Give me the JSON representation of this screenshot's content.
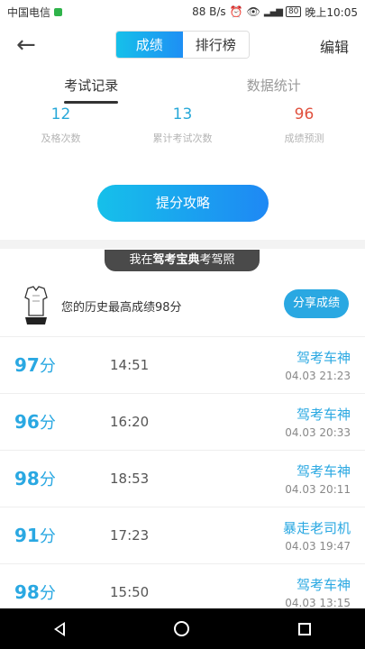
{
  "status": {
    "carrier": "中国电信",
    "speed": "88 B/s",
    "battery": "80",
    "time": "晚上10:05"
  },
  "nav": {
    "back_icon": "arrow-left-icon",
    "seg_active": "成绩",
    "seg_inactive": "排行榜",
    "edit": "编辑"
  },
  "subtabs": [
    "考试记录",
    "数据统计"
  ],
  "stats": [
    {
      "value": "12",
      "label": "及格次数"
    },
    {
      "value": "13",
      "label": "累计考试次数"
    },
    {
      "value": "96",
      "label": "成绩预测"
    }
  ],
  "cta": "提分攻略",
  "banner": {
    "pre": "我在",
    "brand": "驾考宝典",
    "post": "考驾照"
  },
  "best": {
    "text": "您的历史最高成绩98分",
    "share": "分享成绩"
  },
  "records": [
    {
      "score": "97",
      "unit": "分",
      "duration": "14:51",
      "title": "驾考车神",
      "date": "04.03  21:23"
    },
    {
      "score": "96",
      "unit": "分",
      "duration": "16:20",
      "title": "驾考车神",
      "date": "04.03  20:33"
    },
    {
      "score": "98",
      "unit": "分",
      "duration": "18:53",
      "title": "驾考车神",
      "date": "04.03  20:11"
    },
    {
      "score": "91",
      "unit": "分",
      "duration": "17:23",
      "title": "暴走老司机",
      "date": "04.03  19:47"
    },
    {
      "score": "98",
      "unit": "分",
      "duration": "15:50",
      "title": "驾考车神",
      "date": "04.03  13:15"
    }
  ],
  "colors": {
    "accent": "#2aa8e2",
    "prediction": "#e0513e"
  }
}
